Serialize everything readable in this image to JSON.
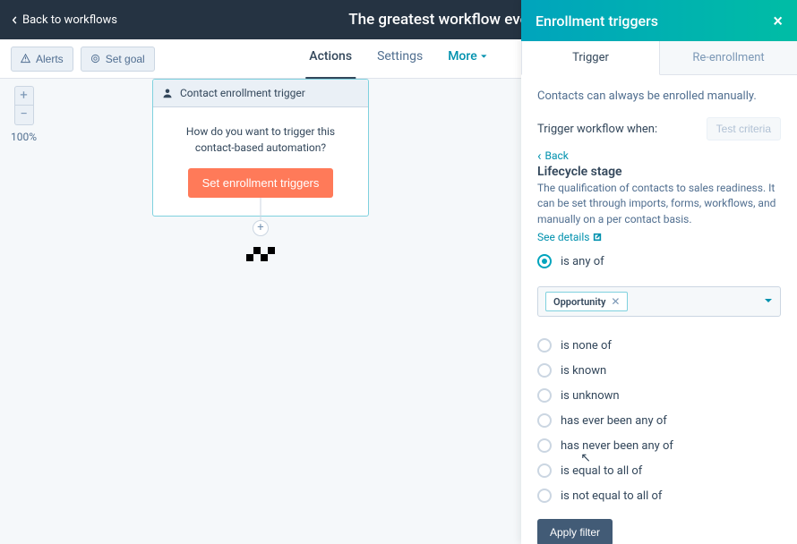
{
  "topbar": {
    "back_label": "Back to workflows",
    "title": "The greatest workflow ever"
  },
  "toolbar": {
    "alerts_label": "Alerts",
    "setgoal_label": "Set goal",
    "tabs": [
      "Actions",
      "Settings",
      "More"
    ]
  },
  "zoom": {
    "level": "100%"
  },
  "trigger_card": {
    "title": "Contact enrollment trigger",
    "question": "How do you want to trigger this contact-based automation?",
    "button": "Set enrollment triggers"
  },
  "panel": {
    "title": "Enrollment triggers",
    "tabs": [
      "Trigger",
      "Re-enrollment"
    ],
    "info": "Contacts can always be enrolled manually.",
    "trigger_when": "Trigger workflow when:",
    "test_criteria": "Test criteria",
    "back_label": "Back",
    "property": {
      "title": "Lifecycle stage",
      "description": "The qualification of contacts to sales readiness. It can be set through imports, forms, workflows, and manually on a per contact basis.",
      "see_details": "See details"
    },
    "selected_token": "Opportunity",
    "operators": [
      "is any of",
      "is none of",
      "is known",
      "is unknown",
      "has ever been any of",
      "has never been any of",
      "is equal to all of",
      "is not equal to all of"
    ],
    "selected_operator_index": 0,
    "apply_label": "Apply filter"
  }
}
